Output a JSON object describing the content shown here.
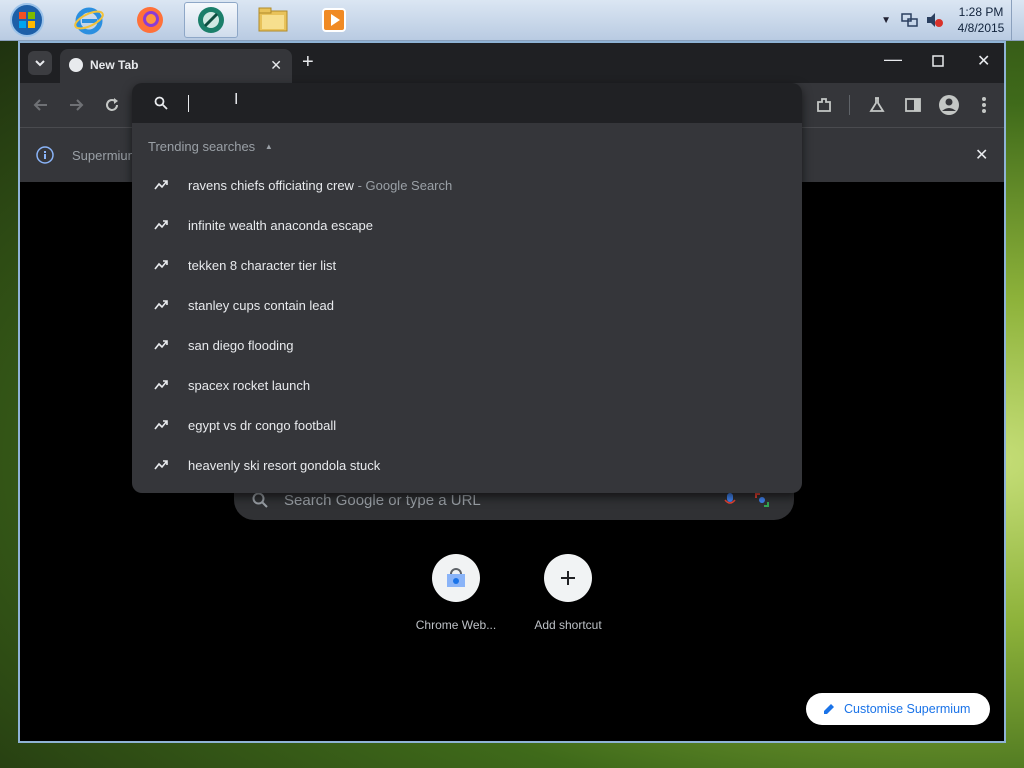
{
  "taskbar": {
    "clock_time": "1:28 PM",
    "clock_date": "4/8/2015",
    "apps": [
      "windows-start-orb",
      "internet-explorer",
      "firefox",
      "supermium",
      "file-explorer",
      "media-player"
    ]
  },
  "browser": {
    "tab_title": "New Tab",
    "infobar_text": "Supermium",
    "omnibox": {
      "value": "",
      "trending_label": "Trending searches",
      "suggestions": [
        {
          "query": "ravens chiefs officiating crew",
          "suffix": " - Google Search"
        },
        {
          "query": "infinite wealth anaconda escape",
          "suffix": ""
        },
        {
          "query": "tekken 8 character tier list",
          "suffix": ""
        },
        {
          "query": "stanley cups contain lead",
          "suffix": ""
        },
        {
          "query": "san diego flooding",
          "suffix": ""
        },
        {
          "query": "spacex rocket launch",
          "suffix": ""
        },
        {
          "query": "egypt vs dr congo football",
          "suffix": ""
        },
        {
          "query": "heavenly ski resort gondola stuck",
          "suffix": ""
        }
      ]
    },
    "ntp": {
      "search_placeholder": "Search Google or type a URL",
      "shortcuts": [
        {
          "label": "Chrome Web..."
        },
        {
          "label": "Add shortcut"
        }
      ],
      "customise_label": "Customise Supermium"
    }
  },
  "colors": {
    "accent": "#1a73e8",
    "toolbar": "#35363a",
    "ntp_bg": "#000000"
  }
}
